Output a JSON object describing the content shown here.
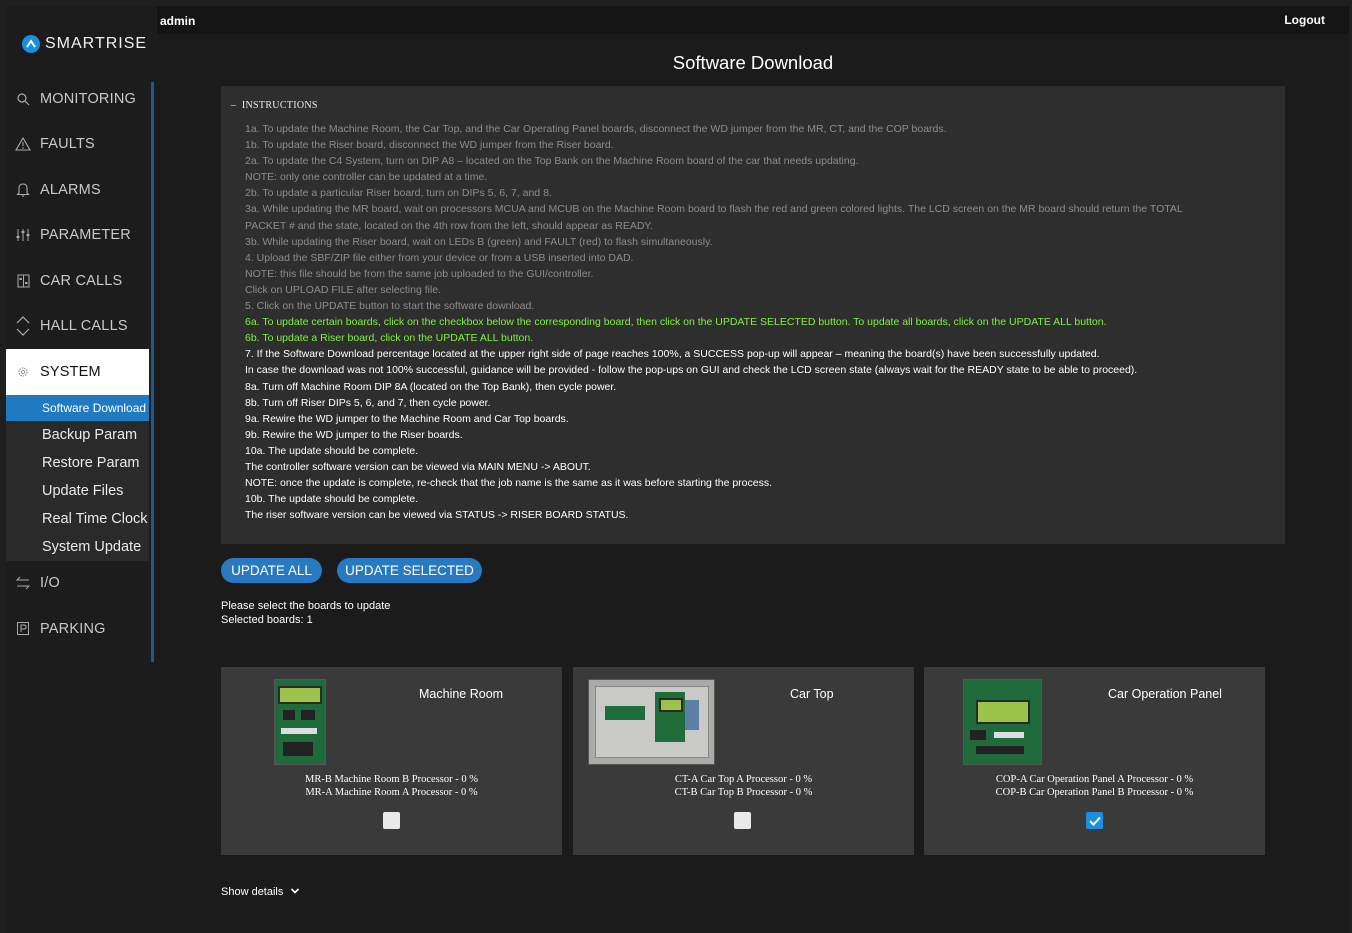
{
  "brand": {
    "name": "SMARTRISE"
  },
  "topbar": {
    "user": "admin",
    "logout": "Logout"
  },
  "nav": {
    "items": [
      {
        "icon": "search-icon",
        "label": "MONITORING"
      },
      {
        "icon": "warning-icon",
        "label": "FAULTS"
      },
      {
        "icon": "bell-icon",
        "label": "ALARMS"
      },
      {
        "icon": "sliders-icon",
        "label": "PARAMETER"
      },
      {
        "icon": "car-calls-icon",
        "label": "CAR CALLS"
      },
      {
        "icon": "up-down-icon",
        "label": "HALL CALLS"
      },
      {
        "icon": "gear-icon",
        "label": "SYSTEM"
      }
    ],
    "system_sub": [
      "Software Download",
      "Backup Param",
      "Restore Param",
      "Update Files",
      "Real Time Clock",
      "System Update"
    ],
    "bottom_items": [
      {
        "icon": "arrows-icon",
        "label": "I/O"
      },
      {
        "icon": "parking-icon",
        "label": "PARKING"
      }
    ]
  },
  "page": {
    "title": "Software Download"
  },
  "instructions": {
    "header": "INSTRUCTIONS",
    "lines": [
      {
        "text": "1a. To update the Machine Room, the Car Top, and the Car Operating Panel boards, disconnect the WD jumper from the MR, CT, and the COP boards.",
        "tone": "grey"
      },
      {
        "text": "1b. To update the Riser board, disconnect the WD jumper from the Riser board.",
        "tone": "grey"
      },
      {
        "text": "2a. To update the C4 System, turn on DIP A8 – located on the Top Bank on the Machine Room board of the car that needs updating.",
        "tone": "grey"
      },
      {
        "text": "NOTE: only one controller can be updated at a time.",
        "tone": "grey"
      },
      {
        "text": "2b. To update a particular Riser board, turn on DIPs 5, 6, 7, and 8.",
        "tone": "grey"
      },
      {
        "text": "3a. While updating the MR board, wait on processors MCUA and MCUB on the Machine Room board to flash the red and green colored lights. The LCD screen on the MR board should return the TOTAL",
        "tone": "grey"
      },
      {
        "text": "PACKET # and the state, located on the 4th row from the left, should appear as READY.",
        "tone": "grey"
      },
      {
        "text": "3b. While updating the Riser board, wait on LEDs B (green) and FAULT (red) to flash simultaneously.",
        "tone": "grey"
      },
      {
        "text": "4. Upload the SBF/ZIP file either from your device or from a USB inserted into DAD.",
        "tone": "grey"
      },
      {
        "text": "NOTE: this file should be from the same job uploaded to the GUI/controller.",
        "tone": "grey"
      },
      {
        "text": "Click on UPLOAD FILE after selecting file.",
        "tone": "grey"
      },
      {
        "text": "5. Click on the UPDATE button to start the software download.",
        "tone": "grey"
      },
      {
        "text": "6a. To update certain boards, click on the checkbox below the corresponding board, then click on the UPDATE SELECTED button. To update all boards, click on the UPDATE ALL button.",
        "tone": "green"
      },
      {
        "text": "6b. To update a Riser board, click on the UPDATE ALL button.",
        "tone": "green"
      },
      {
        "text": "7. If the Software Download percentage located at the upper right side of page reaches 100%, a SUCCESS pop-up will appear – meaning the board(s) have been successfully updated.",
        "tone": "white"
      },
      {
        "text": "In case the download was not 100% successful, guidance will be provided - follow the pop-ups on GUI and check the LCD screen state (always wait for the READY state to be able to proceed).",
        "tone": "white"
      },
      {
        "text": "8a. Turn off Machine Room DIP 8A (located on the Top Bank), then cycle power.",
        "tone": "white"
      },
      {
        "text": "8b. Turn off Riser DIPs 5, 6, and 7, then cycle power.",
        "tone": "white"
      },
      {
        "text": "9a. Rewire the WD jumper to the Machine Room and Car Top boards.",
        "tone": "white"
      },
      {
        "text": "9b. Rewire the WD jumper to the Riser boards.",
        "tone": "white"
      },
      {
        "text": "10a. The update should be complete.",
        "tone": "white"
      },
      {
        "text": "The controller software version can be viewed via MAIN MENU -> ABOUT.",
        "tone": "white"
      },
      {
        "text": "NOTE: once the update is complete, re-check that the job name is the same as it was before starting the process.",
        "tone": "white"
      },
      {
        "text": "10b. The update should be complete.",
        "tone": "white"
      },
      {
        "text": "The riser software version can be viewed via STATUS -> RISER BOARD STATUS.",
        "tone": "white"
      }
    ]
  },
  "buttons": {
    "update_all": "UPDATE ALL",
    "update_selected": "UPDATE SELECTED"
  },
  "status": {
    "prompt": "Please select the boards to update",
    "selected": "Selected boards: 1"
  },
  "boards": [
    {
      "name": "Machine Room",
      "processors": [
        "MR-B Machine Room B Processor - 0 %",
        "MR-A Machine Room A Processor - 0 %"
      ],
      "checked": false
    },
    {
      "name": "Car Top",
      "processors": [
        "CT-A Car Top A Processor - 0 %",
        "CT-B Car Top B Processor - 0 %"
      ],
      "checked": false
    },
    {
      "name": "Car Operation Panel",
      "processors": [
        "COP-A Car Operation Panel A Processor - 0 %",
        "COP-B Car Operation Panel B Processor - 0 %"
      ],
      "checked": true
    }
  ],
  "details": {
    "label": "Show details"
  },
  "colors": {
    "accent": "#1a8fdf",
    "button": "#2979c0",
    "green_text": "#7ef23b"
  }
}
